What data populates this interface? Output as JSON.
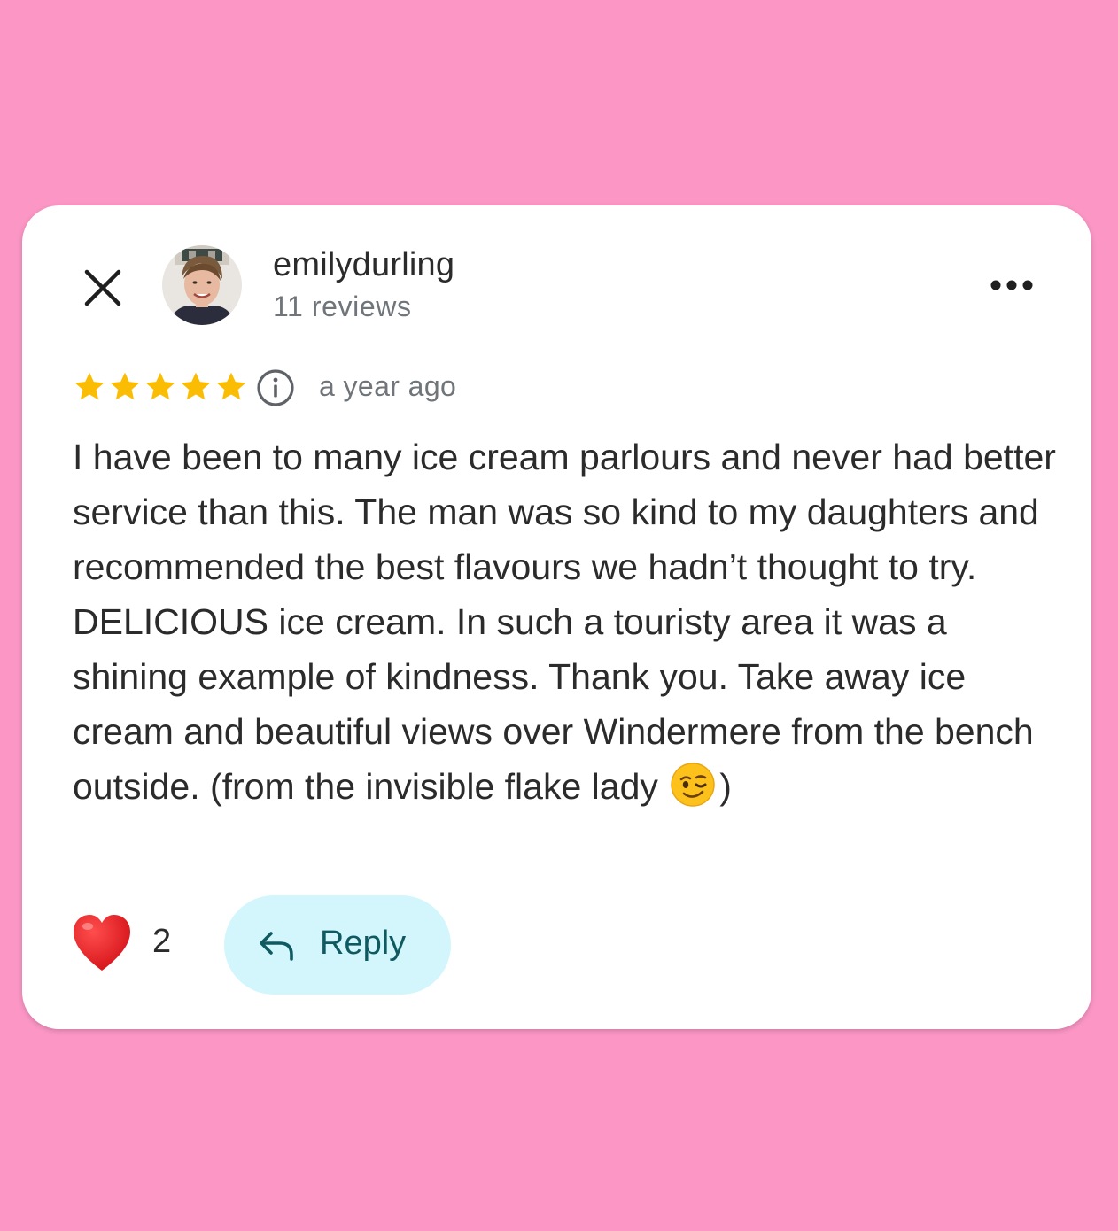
{
  "header": {
    "username": "emilydurling",
    "review_count": "11 reviews"
  },
  "icons": {
    "close": "close-icon",
    "more": "more-horizontal-icon",
    "info": "info-icon",
    "heart": "heart-icon",
    "reply": "reply-arrow-icon",
    "wink": "winking-face-emoji"
  },
  "rating": {
    "stars": 5,
    "max_stars": 5,
    "time_ago": "a year ago"
  },
  "review": {
    "text": "I have been to many ice cream parlours and never had better service than this. The man was so kind to my daughters and recommended the best flavours we hadn’t thought to try. DELICIOUS ice cream. In such a touristy area it was a shining example of kindness. Thank you. Take away ice cream and beautiful views over Windermere from the bench outside. (from the invisible flake lady",
    "text_end": ")"
  },
  "actions": {
    "like_count": "2",
    "reply_label": "Reply"
  },
  "colors": {
    "background": "#fb96c5",
    "card": "#ffffff",
    "star": "#fbbc04",
    "reply_bg": "#d3f5fc",
    "reply_text": "#0f5961",
    "secondary_text": "#70757a"
  }
}
